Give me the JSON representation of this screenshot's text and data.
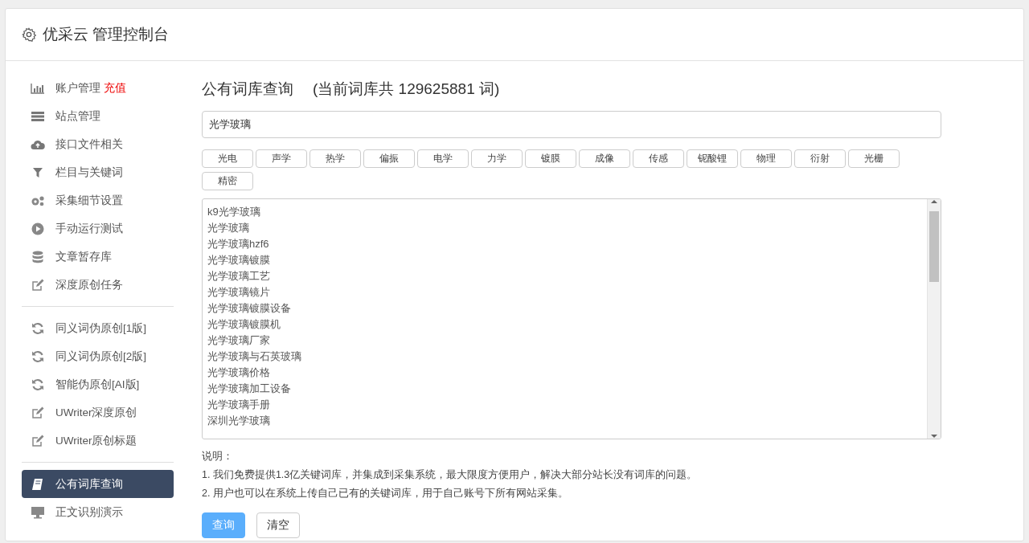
{
  "header": {
    "title": "优采云 管理控制台"
  },
  "sidebar": {
    "sections": [
      {
        "items": [
          {
            "label": "账户管理",
            "badge": "充值",
            "kind": "chart",
            "selected": false
          },
          {
            "label": "站点管理",
            "kind": "server",
            "selected": false
          },
          {
            "label": "接口文件相关",
            "kind": "cloud",
            "selected": false
          },
          {
            "label": "栏目与关键词",
            "kind": "filter",
            "selected": false
          },
          {
            "label": "采集细节设置",
            "kind": "gears",
            "selected": false
          },
          {
            "label": "手动运行测试",
            "kind": "play",
            "selected": false
          },
          {
            "label": "文章暂存库",
            "kind": "database",
            "selected": false
          },
          {
            "label": "深度原创任务",
            "kind": "edit",
            "selected": false
          }
        ]
      },
      {
        "items": [
          {
            "label": "同义词伪原创[1版]",
            "kind": "refresh",
            "selected": false
          },
          {
            "label": "同义词伪原创[2版]",
            "kind": "refresh",
            "selected": false
          },
          {
            "label": "智能伪原创[AI版]",
            "kind": "refresh",
            "selected": false
          },
          {
            "label": "UWriter深度原创",
            "kind": "edit",
            "selected": false
          },
          {
            "label": "UWriter原创标题",
            "kind": "edit",
            "selected": false
          }
        ]
      },
      {
        "items": [
          {
            "label": "公有词库查询",
            "kind": "book",
            "selected": true
          },
          {
            "label": "正文识别演示",
            "kind": "monitor",
            "selected": false
          }
        ]
      }
    ]
  },
  "main": {
    "title": "公有词库查询",
    "count_note": "(当前词库共 129625881 词)",
    "search": {
      "value": "光学玻璃"
    },
    "tags": [
      "光电",
      "声学",
      "热学",
      "偏振",
      "电学",
      "力学",
      "镀膜",
      "成像",
      "传感",
      "铌酸锂",
      "物理",
      "衍射",
      "光栅",
      "精密"
    ],
    "results": [
      "k9光学玻璃",
      "光学玻璃",
      "光学玻璃hzf6",
      "光学玻璃镀膜",
      "光学玻璃工艺",
      "光学玻璃镜片",
      "光学玻璃镀膜设备",
      "光学玻璃镀膜机",
      "光学玻璃厂家",
      "光学玻璃与石英玻璃",
      "光学玻璃价格",
      "光学玻璃加工设备",
      "光学玻璃手册",
      "深圳光学玻璃"
    ],
    "notes_title": "说明：",
    "notes": [
      "1. 我们免费提供1.3亿关键词库，并集成到采集系统，最大限度方便用户，解决大部分站长没有词库的问题。",
      "2. 用户也可以在系统上传自己已有的关键词库，用于自己账号下所有网站采集。"
    ],
    "buttons": [
      {
        "label": "查询",
        "kind": "primary"
      },
      {
        "label": "清空",
        "kind": "default"
      }
    ]
  }
}
